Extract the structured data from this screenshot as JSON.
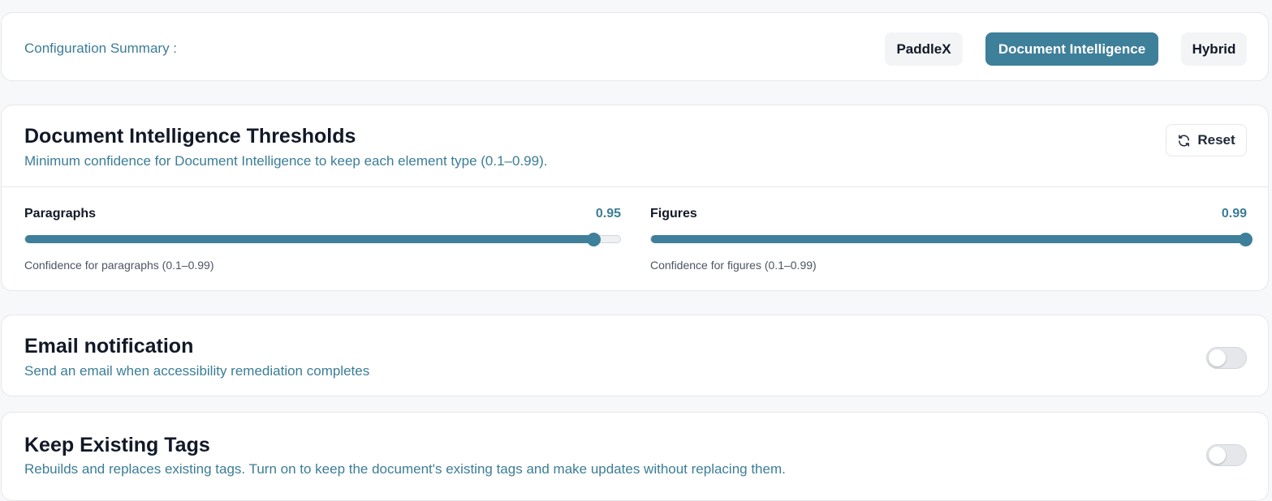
{
  "summary": {
    "label": "Configuration Summary :",
    "modes": [
      {
        "label": "PaddleX",
        "active": false
      },
      {
        "label": "Document Intelligence",
        "active": true
      },
      {
        "label": "Hybrid",
        "active": false
      }
    ]
  },
  "thresholds": {
    "title": "Document Intelligence Thresholds",
    "subtitle": "Minimum confidence for Document Intelligence to keep each element type (0.1–0.99).",
    "reset_label": "Reset",
    "sliders": [
      {
        "label": "Paragraphs",
        "value": "0.95",
        "numeric": 0.95,
        "min": 0.1,
        "max": 0.99,
        "help": "Confidence for paragraphs (0.1–0.99)"
      },
      {
        "label": "Figures",
        "value": "0.99",
        "numeric": 0.99,
        "min": 0.1,
        "max": 0.99,
        "help": "Confidence for figures (0.1–0.99)"
      }
    ]
  },
  "email": {
    "title": "Email notification",
    "subtitle": "Send an email when accessibility remediation completes",
    "enabled": false
  },
  "keep_tags": {
    "title": "Keep Existing Tags",
    "subtitle": "Rebuilds and replaces existing tags. Turn on to keep the document's existing tags and make updates without replacing them.",
    "enabled": false
  },
  "colors": {
    "accent": "#3e7f9a",
    "accent_text": "#3b7d96"
  }
}
